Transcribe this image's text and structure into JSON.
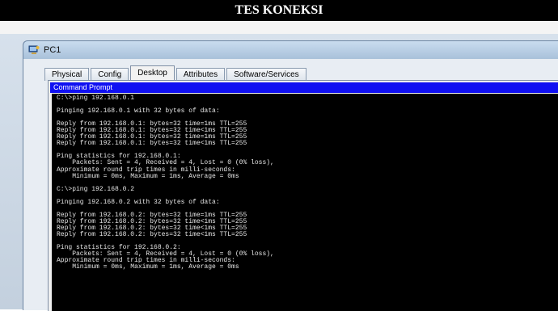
{
  "document": {
    "heading": "TES KONEKSI"
  },
  "window": {
    "title": "PC1"
  },
  "tabs": [
    {
      "label": "Physical"
    },
    {
      "label": "Config"
    },
    {
      "label": "Desktop"
    },
    {
      "label": "Attributes"
    },
    {
      "label": "Software/Services"
    }
  ],
  "active_tab": "Desktop",
  "command_prompt": {
    "title": "Command Prompt",
    "output": "C:\\>ping 192.168.0.1\n\nPinging 192.168.0.1 with 32 bytes of data:\n\nReply from 192.168.0.1: bytes=32 time=1ms TTL=255\nReply from 192.168.0.1: bytes=32 time<1ms TTL=255\nReply from 192.168.0.1: bytes=32 time=1ms TTL=255\nReply from 192.168.0.1: bytes=32 time<1ms TTL=255\n\nPing statistics for 192.168.0.1:\n    Packets: Sent = 4, Received = 4, Lost = 0 (0% loss),\nApproximate round trip times in milli-seconds:\n    Minimum = 0ms, Maximum = 1ms, Average = 0ms\n\nC:\\>ping 192.168.0.2\n\nPinging 192.168.0.2 with 32 bytes of data:\n\nReply from 192.168.0.2: bytes=32 time=1ms TTL=255\nReply from 192.168.0.2: bytes=32 time<1ms TTL=255\nReply from 192.168.0.2: bytes=32 time<1ms TTL=255\nReply from 192.168.0.2: bytes=32 time<1ms TTL=255\n\nPing statistics for 192.168.0.2:\n    Packets: Sent = 4, Received = 4, Lost = 0 (0% loss),\nApproximate round trip times in milli-seconds:\n    Minimum = 0ms, Maximum = 1ms, Average = 0ms"
  },
  "colors": {
    "command_title_bar": "#1010f2",
    "console_background": "#000000",
    "console_text": "#e6e6e6"
  }
}
